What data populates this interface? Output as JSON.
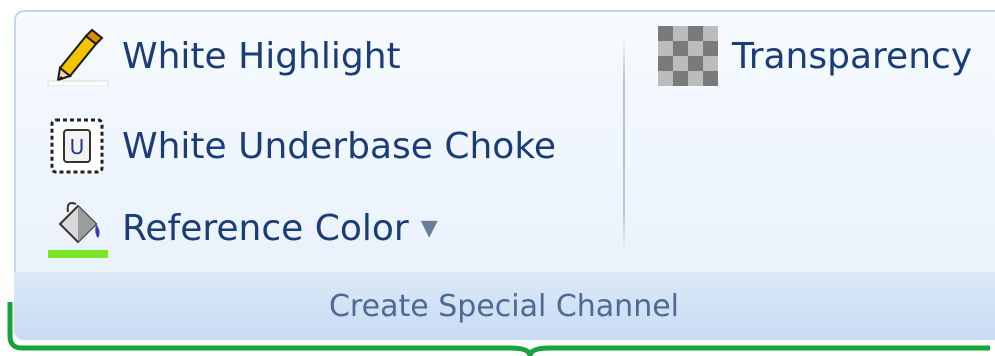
{
  "group": {
    "label": "Create Special Channel",
    "items": [
      {
        "label": "White Highlight",
        "icon": "pencil-highlight-icon"
      },
      {
        "label": "White Underbase Choke",
        "icon": "underbase-choke-icon"
      },
      {
        "label": "Reference Color",
        "icon": "paint-bucket-icon",
        "has_dropdown": true
      },
      {
        "label": "Transparency",
        "icon": "checkerboard-icon"
      }
    ]
  },
  "colors": {
    "label_text": "#1a3d78",
    "group_label": "#4c6a94",
    "highlight_underline": "#ffffff",
    "reference_underline": "#7be52b",
    "annotation_bracket": "#17a33b"
  }
}
